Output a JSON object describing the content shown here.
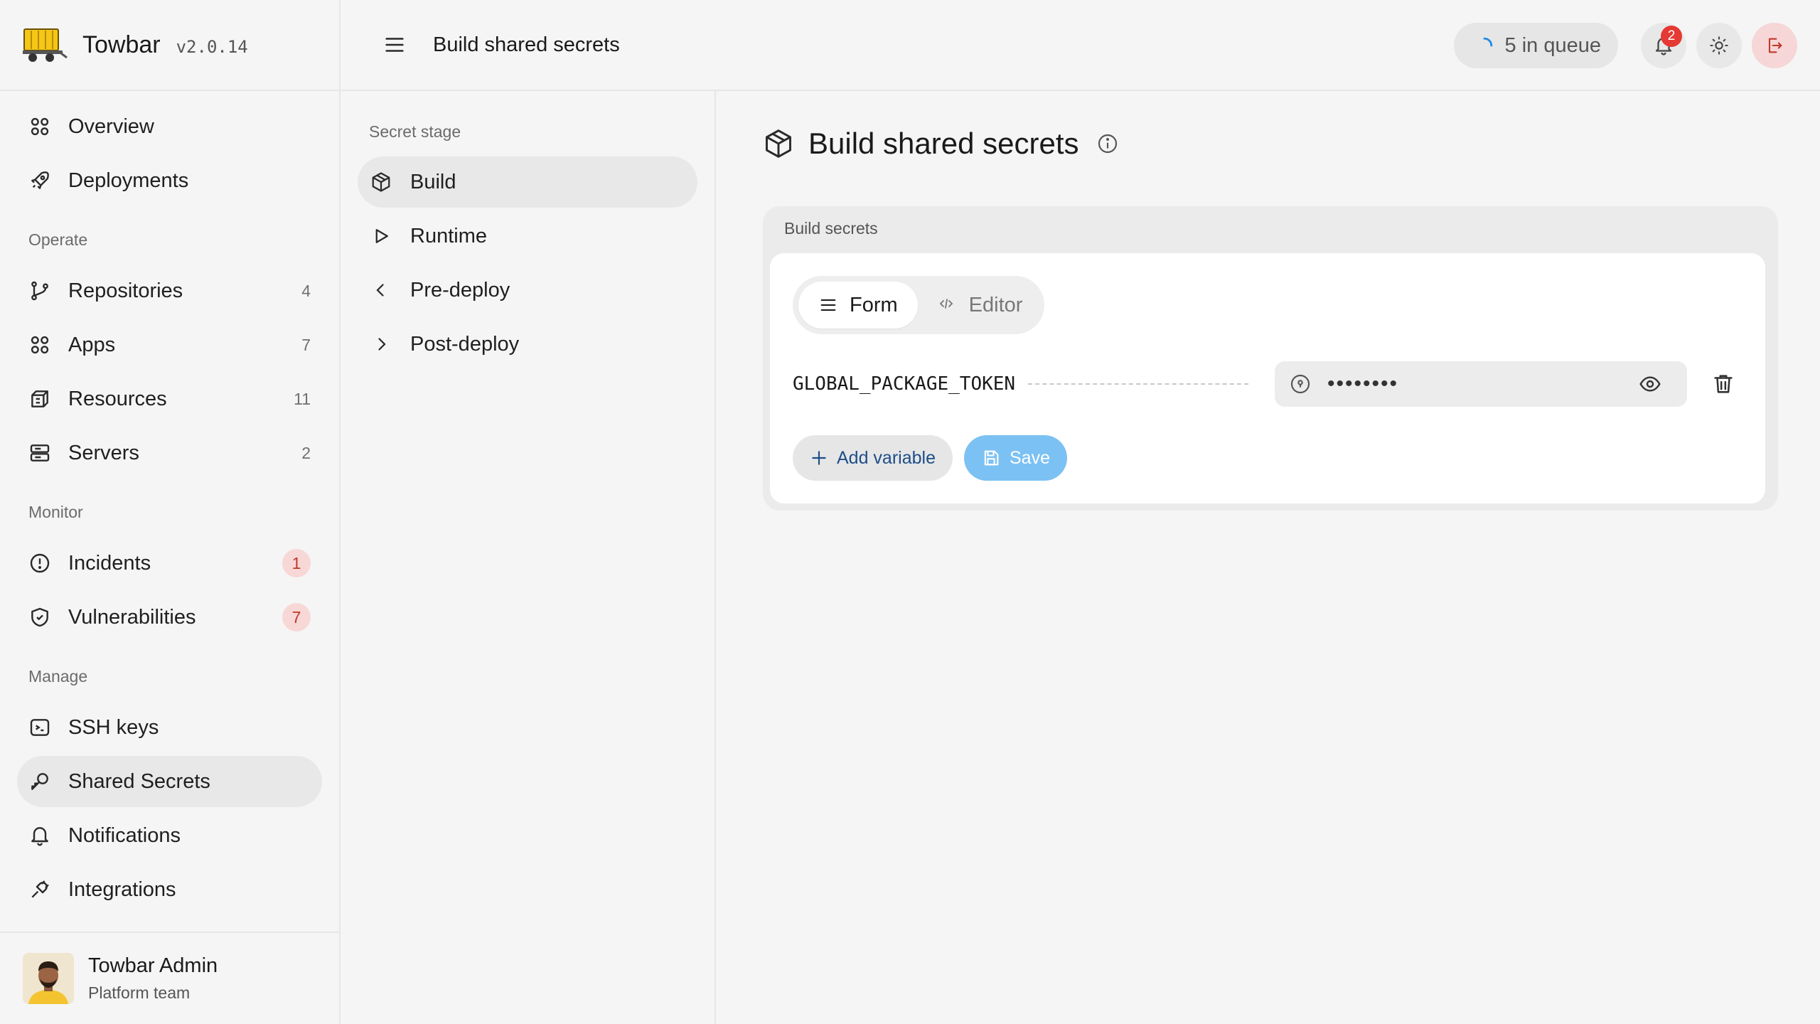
{
  "app": {
    "name": "Towbar",
    "version": "v2.0.14"
  },
  "sidebar": {
    "top_items": [
      {
        "label": "Overview"
      },
      {
        "label": "Deployments"
      }
    ],
    "sections": [
      {
        "title": "Operate",
        "items": [
          {
            "label": "Repositories",
            "count": "4"
          },
          {
            "label": "Apps",
            "count": "7"
          },
          {
            "label": "Resources",
            "count": "11"
          },
          {
            "label": "Servers",
            "count": "2"
          }
        ]
      },
      {
        "title": "Monitor",
        "items": [
          {
            "label": "Incidents",
            "badge": "1"
          },
          {
            "label": "Vulnerabilities",
            "badge": "7"
          }
        ]
      },
      {
        "title": "Manage",
        "items": [
          {
            "label": "SSH keys"
          },
          {
            "label": "Shared Secrets",
            "active": true
          },
          {
            "label": "Notifications"
          },
          {
            "label": "Integrations"
          }
        ]
      }
    ],
    "user": {
      "name": "Towbar Admin",
      "team": "Platform team"
    }
  },
  "topbar": {
    "title": "Build shared secrets",
    "queue_label": "5 in queue",
    "notification_count": "2"
  },
  "stage_panel": {
    "title": "Secret stage",
    "items": [
      {
        "label": "Build",
        "active": true
      },
      {
        "label": "Runtime"
      },
      {
        "label": "Pre-deploy"
      },
      {
        "label": "Post-deploy"
      }
    ]
  },
  "main": {
    "heading": "Build shared secrets",
    "card_label": "Build secrets",
    "tabs": [
      {
        "label": "Form",
        "active": true
      },
      {
        "label": "Editor"
      }
    ],
    "variables": [
      {
        "name": "GLOBAL_PACKAGE_TOKEN",
        "masked_value": "••••••••"
      }
    ],
    "add_label": "Add variable",
    "save_label": "Save"
  },
  "colors": {
    "accent": "#7cc1f3",
    "link": "#1d4e89",
    "danger": "#e53935",
    "badge_bg": "#f8d7d7"
  }
}
